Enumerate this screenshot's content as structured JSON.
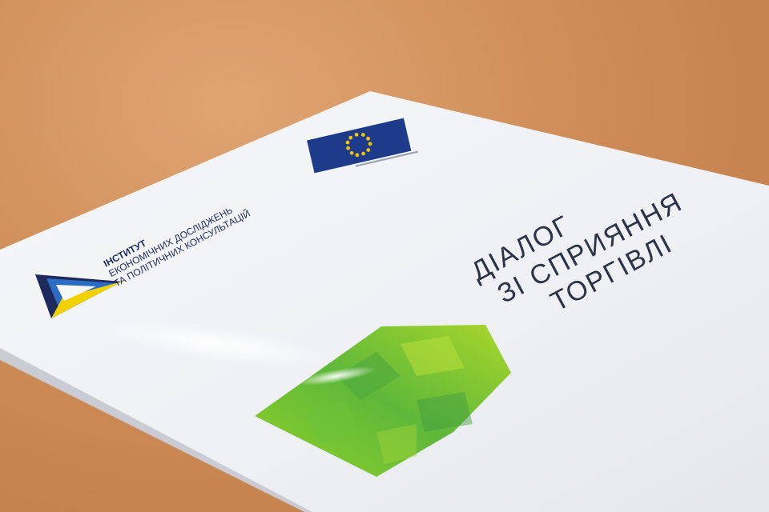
{
  "photo": {
    "subject": "booklet on wooden table",
    "colors": {
      "table": "#cf8c57",
      "cover": "#f2f4f7",
      "eu_blue": "#1e3a8a",
      "eu_stars": "#f2c200",
      "logo_navy": "#1f2a5c",
      "logo_blue": "#2b6cc4",
      "logo_yellow": "#f2d100",
      "house_green": "#7cc42a"
    }
  },
  "booklet": {
    "institute": {
      "line1": "ІНСТИТУТ",
      "line2": "ЕКОНОМІЧНИХ ДОСЛІДЖЕНЬ",
      "line3": "ТА ПОЛІТИЧНИХ КОНСУЛЬТАЦІЙ"
    },
    "title": {
      "line1": "ДІАЛОГ",
      "line2": "ЗІ СПРИЯННЯ",
      "line3": "ТОРГІВЛІ"
    }
  }
}
